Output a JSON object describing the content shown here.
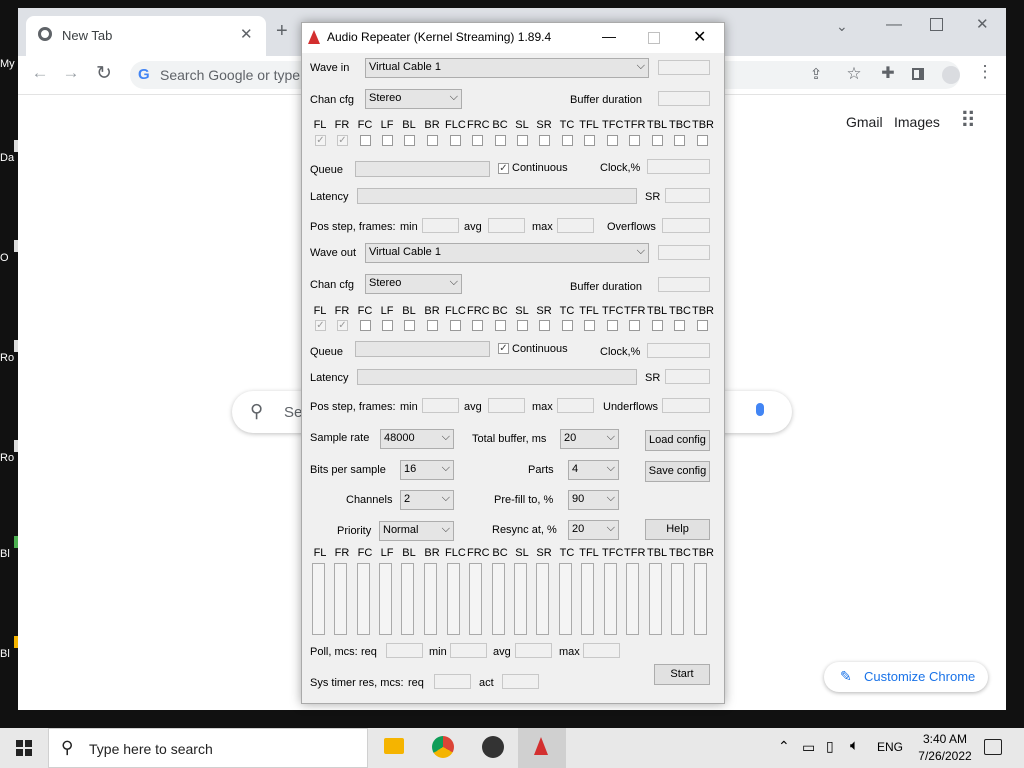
{
  "desktop": {
    "icons": [
      "My",
      "Da",
      "O",
      "Ro",
      "Ro",
      "Bl",
      "Bl"
    ]
  },
  "browser": {
    "tab_title": "New Tab",
    "omnibox_placeholder": "Search Google or type",
    "gmail": "Gmail",
    "images": "Images",
    "search_placeholder": "Se",
    "customize": "Customize Chrome"
  },
  "audio_repeater": {
    "title": "Audio Repeater (Kernel Streaming) 1.89.4",
    "channel_labels": [
      "FL",
      "FR",
      "FC",
      "LF",
      "BL",
      "BR",
      "FLC",
      "FRC",
      "BC",
      "SL",
      "SR",
      "TC",
      "TFL",
      "TFC",
      "TFR",
      "TBL",
      "TBC",
      "TBR"
    ],
    "wave_in": {
      "label": "Wave in",
      "device": "Virtual Cable 1",
      "chan_cfg_label": "Chan cfg",
      "chan_cfg": "Stereo",
      "buffer_duration_label": "Buffer duration",
      "checked": [
        true,
        true,
        false,
        false,
        false,
        false,
        false,
        false,
        false,
        false,
        false,
        false,
        false,
        false,
        false,
        false,
        false,
        false
      ],
      "queue_label": "Queue",
      "continuous_label": "Continuous",
      "continuous_checked": true,
      "clock_label": "Clock,%",
      "latency_label": "Latency",
      "sr_label": "SR",
      "pos_step_label": "Pos step, frames:",
      "min_label": "min",
      "avg_label": "avg",
      "max_label": "max",
      "overflow_label": "Overflows"
    },
    "wave_out": {
      "label": "Wave out",
      "device": "Virtual Cable 1",
      "chan_cfg_label": "Chan cfg",
      "chan_cfg": "Stereo",
      "buffer_duration_label": "Buffer duration",
      "checked": [
        true,
        true,
        false,
        false,
        false,
        false,
        false,
        false,
        false,
        false,
        false,
        false,
        false,
        false,
        false,
        false,
        false,
        false
      ],
      "queue_label": "Queue",
      "continuous_label": "Continuous",
      "continuous_checked": true,
      "clock_label": "Clock,%",
      "latency_label": "Latency",
      "sr_label": "SR",
      "pos_step_label": "Pos step, frames:",
      "min_label": "min",
      "avg_label": "avg",
      "max_label": "max",
      "underflow_label": "Underflows"
    },
    "settings": {
      "sample_rate_label": "Sample rate",
      "sample_rate": "48000",
      "total_buffer_label": "Total buffer, ms",
      "total_buffer": "20",
      "bits_label": "Bits per sample",
      "bits": "16",
      "parts_label": "Parts",
      "parts": "4",
      "channels_label": "Channels",
      "channels": "2",
      "prefill_label": "Pre-fill to, %",
      "prefill": "90",
      "priority_label": "Priority",
      "priority": "Normal",
      "resync_label": "Resync at, %",
      "resync": "20"
    },
    "buttons": {
      "load_config": "Load config",
      "save_config": "Save config",
      "help": "Help",
      "start": "Start"
    },
    "stats": {
      "poll_label": "Poll, mcs:",
      "req_label": "req",
      "min_label": "min",
      "avg_label": "avg",
      "max_label": "max",
      "sys_timer_label": "Sys timer res, mcs:",
      "act_label": "act"
    }
  },
  "taskbar": {
    "search_placeholder": "Type here to search",
    "lang": "ENG",
    "time": "3:40 AM",
    "date": "7/26/2022"
  }
}
